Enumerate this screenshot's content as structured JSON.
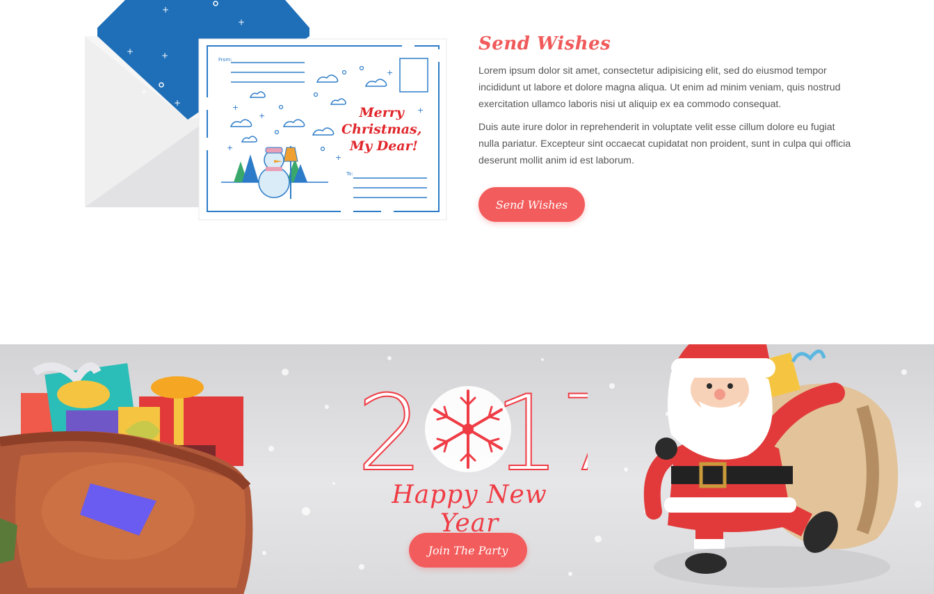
{
  "postcard": {
    "from_label": "From:",
    "to_label": "To:",
    "greeting_lines": [
      "Merry",
      "Christmas,",
      "My Dear!"
    ]
  },
  "wishes": {
    "title": "Send Wishes",
    "paragraph_1": "Lorem ipsum dolor sit amet, consectetur adipisicing elit, sed do eiusmod tempor incididunt ut labore et dolore magna aliqua. Ut enim ad minim veniam, quis nostrud exercitation ullamco laboris nisi ut aliquip ex ea commodo consequat.",
    "paragraph_2": "Duis aute irure dolor in reprehenderit in voluptate velit esse cillum dolore eu fugiat nulla pariatur. Excepteur sint occaecat cupidatat non proident, sunt in culpa qui officia deserunt mollit anim id est laborum.",
    "button_label": "Send Wishes"
  },
  "banner": {
    "year_left": "2",
    "year_right": "17",
    "subtitle": "Happy New Year",
    "button_label": "Join The Party"
  },
  "colors": {
    "accent": "#f35c5c",
    "title_red": "#f05a5a",
    "envelope_blue": "#1f6fb8",
    "banner_bg": "#dcdcde"
  },
  "icons": [
    "envelope-icon",
    "postcard-icon",
    "snowman-icon",
    "gift-sack-icon",
    "snowflake-icon",
    "santa-icon"
  ]
}
